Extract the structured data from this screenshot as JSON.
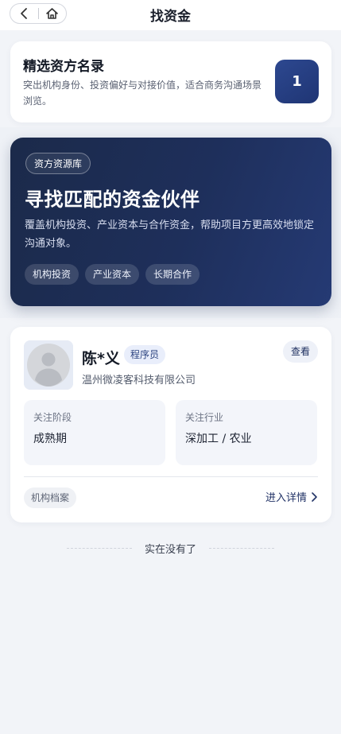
{
  "header": {
    "title": "找资金",
    "back_icon": "chevron-left-icon",
    "home_icon": "home-icon"
  },
  "intro": {
    "title": "精选资方名录",
    "description": "突出机构身份、投资偏好与对接价值，适合商务沟通场景浏览。",
    "count": "1"
  },
  "banner": {
    "badge": "资方资源库",
    "title": "寻找匹配的资金伙伴",
    "description": "覆盖机构投资、产业资本与合作资金，帮助项目方更高效地锁定沟通对象。",
    "tags": [
      "机构投资",
      "产业资本",
      "长期合作"
    ]
  },
  "investors": [
    {
      "name": "陈*义",
      "role": "程序员",
      "company": "温州微凌客科技有限公司",
      "view_label": "查看",
      "stage_label": "关注阶段",
      "stage_value": "成熟期",
      "industry_label": "关注行业",
      "industry_value": "深加工 / 农业",
      "archive_label": "机构档案",
      "detail_label": "进入详情"
    }
  ],
  "footer": {
    "end_text": "实在没有了"
  },
  "colors": {
    "accent": "#1f3574",
    "banner_start": "#1b2a4a",
    "banner_end": "#253a74",
    "background": "#f2f4f8"
  }
}
